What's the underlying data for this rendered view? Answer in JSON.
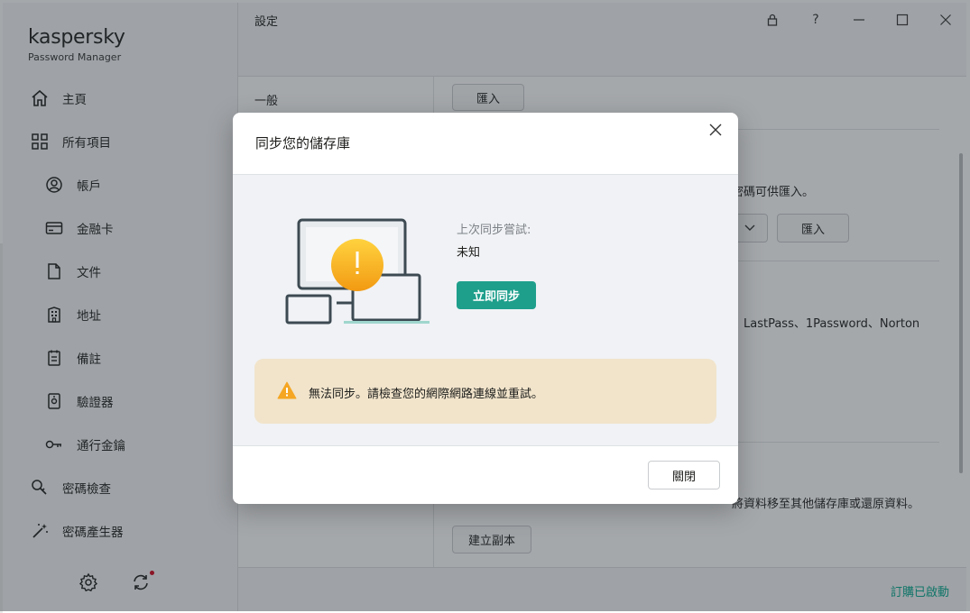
{
  "app": {
    "logo_text": "kaspersky",
    "subtitle": "Password Manager"
  },
  "sidebar": {
    "items": [
      {
        "label": "主頁",
        "icon": "home-icon"
      },
      {
        "label": "所有項目",
        "icon": "grid-icon"
      },
      {
        "label": "帳戶",
        "icon": "account-icon"
      },
      {
        "label": "金融卡",
        "icon": "card-icon"
      },
      {
        "label": "文件",
        "icon": "document-icon"
      },
      {
        "label": "地址",
        "icon": "building-icon"
      },
      {
        "label": "備註",
        "icon": "note-icon"
      },
      {
        "label": "驗證器",
        "icon": "authenticator-icon"
      },
      {
        "label": "通行金鑰",
        "icon": "key-icon"
      },
      {
        "label": "密碼檢查",
        "icon": "password-check-icon"
      },
      {
        "label": "密碼產生器",
        "icon": "magic-wand-icon"
      }
    ],
    "bottom_icons": [
      "settings-icon",
      "sync-icon"
    ]
  },
  "window": {
    "title": "設定",
    "controls": [
      "lock-icon",
      "help-icon",
      "minimize-icon",
      "maximize-icon",
      "close-icon"
    ]
  },
  "settings_nav": {
    "general": "一般"
  },
  "content": {
    "import_button_top": "匯入",
    "text_import_partial": "密碼可供匯入。",
    "import_button_mid": "匯入",
    "text_managers_partial": "、LastPass、1Password、Norton",
    "text_backup_partial": "將資料移至其他儲存庫或還原資料。",
    "backup_button": "建立副本"
  },
  "footer": {
    "subscription_status": "訂購已啟動"
  },
  "dialog": {
    "title": "同步您的儲存庫",
    "last_sync_label": "上次同步嘗試:",
    "last_sync_value": "未知",
    "sync_now_button": "立即同步",
    "warning_text": "無法同步。請檢查您的網際網路連線並重試。",
    "close_button": "關閉"
  },
  "colors": {
    "accent": "#1e9f8c",
    "warning_bg": "#f1e4cb",
    "warning_icon": "#f5a623"
  }
}
